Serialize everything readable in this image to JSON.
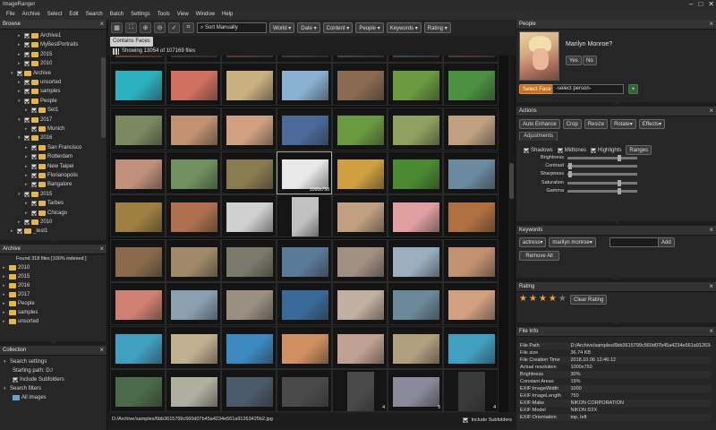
{
  "app": {
    "title": "ImageRanger"
  },
  "window_controls": [
    "–",
    "□",
    "✕"
  ],
  "menu": [
    "File",
    "Archive",
    "Select",
    "Edit",
    "Search",
    "Batch",
    "Settings",
    "Tools",
    "View",
    "Window",
    "Help"
  ],
  "browse": {
    "title": "Browse",
    "rows": [
      {
        "label": "Archive1",
        "depth": 2,
        "checked": true
      },
      {
        "label": "MyBestPortraits",
        "depth": 2,
        "checked": true
      },
      {
        "label": "2015",
        "depth": 2,
        "checked": true
      },
      {
        "label": "2010",
        "depth": 2,
        "checked": true
      },
      {
        "label": "Archive",
        "depth": 1,
        "checked": true,
        "arrow": "▾"
      },
      {
        "label": "unsorted",
        "depth": 2,
        "checked": true
      },
      {
        "label": "samples",
        "depth": 2,
        "checked": true
      },
      {
        "label": "People",
        "depth": 2,
        "checked": true,
        "arrow": "▾"
      },
      {
        "label": "Set1",
        "depth": 3,
        "checked": true
      },
      {
        "label": "2017",
        "depth": 2,
        "checked": true,
        "arrow": "▾"
      },
      {
        "label": "Munich",
        "depth": 3,
        "checked": true
      },
      {
        "label": "2016",
        "depth": 2,
        "checked": true,
        "arrow": "▾"
      },
      {
        "label": "San Francisco",
        "depth": 3,
        "checked": true
      },
      {
        "label": "Rotterdam",
        "depth": 3,
        "checked": true
      },
      {
        "label": "New Taipei",
        "depth": 3,
        "checked": true
      },
      {
        "label": "Florianopolis",
        "depth": 3,
        "checked": true
      },
      {
        "label": "Bangalore",
        "depth": 3,
        "checked": true
      },
      {
        "label": "2015",
        "depth": 2,
        "checked": true,
        "arrow": "▾"
      },
      {
        "label": "Tarbes",
        "depth": 3,
        "checked": true
      },
      {
        "label": "Chicago",
        "depth": 3,
        "checked": true
      },
      {
        "label": "2010",
        "depth": 2,
        "checked": true
      },
      {
        "label": "_test1",
        "depth": 1,
        "checked": true
      }
    ]
  },
  "archive": {
    "title": "Archive",
    "found": "Found 318 files [100% indexed ]",
    "items": [
      "2010",
      "2015",
      "2016",
      "2017",
      "People",
      "samples",
      "unsorted"
    ]
  },
  "collection": {
    "title": "Collection",
    "items": [
      {
        "label": "Search settings",
        "depth": 0
      },
      {
        "label": "Starting path: D:/",
        "depth": 1
      },
      {
        "label": "Include Subfolders",
        "depth": 1,
        "checkbox": true
      },
      {
        "label": "Search filters",
        "depth": 0
      },
      {
        "label": "All images",
        "depth": 1,
        "icon": true
      }
    ]
  },
  "toolbar": {
    "icons": [
      "grid-view-icon",
      "fullscreen-icon",
      "zoom-in-icon",
      "zoom-out-icon",
      "check-icon",
      "crop-icon"
    ],
    "sort": "Sort Manually",
    "filters": [
      "World",
      "Date",
      "Content",
      "People",
      "Keywords",
      "Rating"
    ]
  },
  "filter_chip": "Contains Faces",
  "count_text": "Showing 13054 of 107169 files",
  "grid": {
    "colors": [
      [
        "#5a4638",
        "#3b3a34",
        "#4b3f38",
        "#3f3a3a",
        "#4a4040",
        "#3c4a3c",
        "#4a3b34"
      ],
      [
        "#2bb0c0",
        "#d07060",
        "#c8b080",
        "#8ab0d0",
        "#8a6a50",
        "#6a9a40",
        "#4a9040"
      ],
      [
        "#7a8a60",
        "#c09070",
        "#d0a080",
        "#4a6a9a",
        "#6a9a40",
        "#90a060",
        "#c0a080"
      ],
      [
        "#c0907a",
        "#709060",
        "#8a7a50",
        "#e8e8e8",
        "#d0a040",
        "#4a8a30",
        "#6a8aa0"
      ],
      [
        "#a08040",
        "#b07050",
        "#d0d0d0",
        "#c0c0c0",
        "#c0a080",
        "#e0a0a0",
        "#b07040"
      ],
      [
        "#8a6a4a",
        "#a08a6a",
        "#7a7a6a",
        "#5a7a9a",
        "#a09080",
        "#9ab0c0",
        "#c09070"
      ],
      [
        "#d08070",
        "#8aa0b0",
        "#9a9080",
        "#3a6a9a",
        "#c0b0a0",
        "#6a8a9a",
        "#d0a080"
      ],
      [
        "#40a0c0",
        "#c0b090",
        "#3a8ac0",
        "#d09060",
        "#c0a090",
        "#b0a080",
        "#40a0c0"
      ],
      [
        "#4a6a4a",
        "#b0b0a0",
        "#4a5a6a",
        "#4a4a4a",
        "#4a4a4a",
        "#8a8a9a",
        "#3a3a3a"
      ]
    ],
    "tall": [
      [
        4,
        3
      ],
      [
        8,
        4
      ],
      [
        8,
        6
      ]
    ],
    "tags": [
      {
        "r": 3,
        "c": 3,
        "text": "1000x750"
      },
      {
        "r": 8,
        "c": 4,
        "text": "4"
      },
      {
        "r": 8,
        "c": 5,
        "text": "5"
      },
      {
        "r": 8,
        "c": 6,
        "text": "4"
      }
    ]
  },
  "status": {
    "path": "D:/Archive/samples/6bb3615799c560d07b45a4234e561a91263425b2.jpg",
    "include_subfolders": "Include Subfolders"
  },
  "people": {
    "title": "People",
    "question": "Marilyn Monroe?",
    "yes": "Yes",
    "no": "No",
    "select_face": "Select Face",
    "select_person": "-select person-",
    "add": "+"
  },
  "actions": {
    "title": "Actions",
    "buttons": [
      "Auto Enhance",
      "Crop",
      "Resize",
      "Rotate",
      "Effects"
    ],
    "adjustments_tab": "Adjustments",
    "checks": [
      "Shadows",
      "Midtones",
      "Highlights"
    ],
    "ranges": "Ranges",
    "sliders": [
      {
        "label": "Brightness",
        "value": 0.75
      },
      {
        "label": "Contrast",
        "value": 0.02
      },
      {
        "label": "Sharpness",
        "value": 0.02
      },
      {
        "label": "Saturation",
        "value": 0.75
      },
      {
        "label": "Gamma",
        "value": 0.75
      }
    ]
  },
  "keywords": {
    "title": "Keywords",
    "tags": [
      "actress",
      "marilyn monroe"
    ],
    "input": "",
    "add": "Add",
    "remove_all": "Remove All"
  },
  "rating": {
    "title": "Rating",
    "stars": 4,
    "max": 5,
    "clear": "Clear Rating"
  },
  "fileinfo": {
    "title": "File Info",
    "rows": [
      [
        "File Path",
        "D:/Archive/samples/6bb3615799c560d07b45a4234e561a91263425b2.jpg"
      ],
      [
        "File size",
        "36.74 KB"
      ],
      [
        "File Creation Time",
        "2018.10.06 12:46:12"
      ],
      [
        "Actual resolution",
        "1000x750"
      ],
      [
        "Brightness",
        "30%"
      ],
      [
        "Constant Areas",
        "19%"
      ],
      [
        "EXIF:ImageWidth",
        "1000"
      ],
      [
        "EXIF:ImageLength",
        "750"
      ],
      [
        "EXIF:Make",
        "NIKON CORPORATION"
      ],
      [
        "EXIF:Model",
        "NIKON D2X"
      ],
      [
        "EXIF:Orientation",
        "top, left"
      ]
    ]
  }
}
